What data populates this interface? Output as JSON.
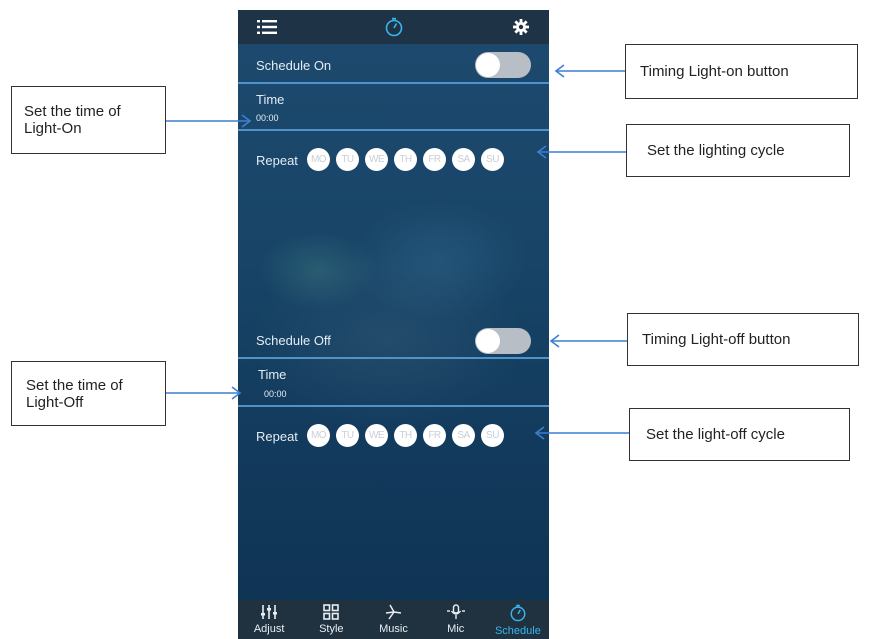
{
  "topbar": {
    "left_icon": "list-icon",
    "center_icon": "timer-icon",
    "right_icon": "gear-icon"
  },
  "schedule_on": {
    "label": "Schedule On",
    "toggle_on": false,
    "time_label": "Time",
    "time_value": "00:00",
    "repeat_label": "Repeat",
    "days": [
      "MO",
      "TU",
      "WE",
      "TH",
      "FR",
      "SA",
      "SU"
    ]
  },
  "schedule_off": {
    "label": "Schedule Off",
    "toggle_on": false,
    "time_label": "Time",
    "time_value": "00:00",
    "repeat_label": "Repeat",
    "days": [
      "MO",
      "TU",
      "WE",
      "TH",
      "FR",
      "SA",
      "SU"
    ]
  },
  "tabs": [
    {
      "label": "Adjust",
      "icon": "sliders-icon"
    },
    {
      "label": "Style",
      "icon": "grid-icon"
    },
    {
      "label": "Music",
      "icon": "music-icon"
    },
    {
      "label": "Mic",
      "icon": "mic-icon"
    },
    {
      "label": "Schedule",
      "icon": "timer-icon",
      "active": true
    }
  ],
  "annotations": {
    "light_on_button": "Timing Light-on button",
    "light_on_time_line1": "Set the time of",
    "light_on_time_line2": "Light-On",
    "lighting_cycle": "Set the lighting cycle",
    "light_off_button": "Timing Light-off button",
    "light_off_time_line1": "Set the time of",
    "light_off_time_line2": "Light-Off",
    "light_off_cycle": "Set the light-off cycle"
  },
  "colors": {
    "accent": "#38b5ee",
    "separator": "#4f93c9",
    "arrow": "#3d7fd1"
  }
}
